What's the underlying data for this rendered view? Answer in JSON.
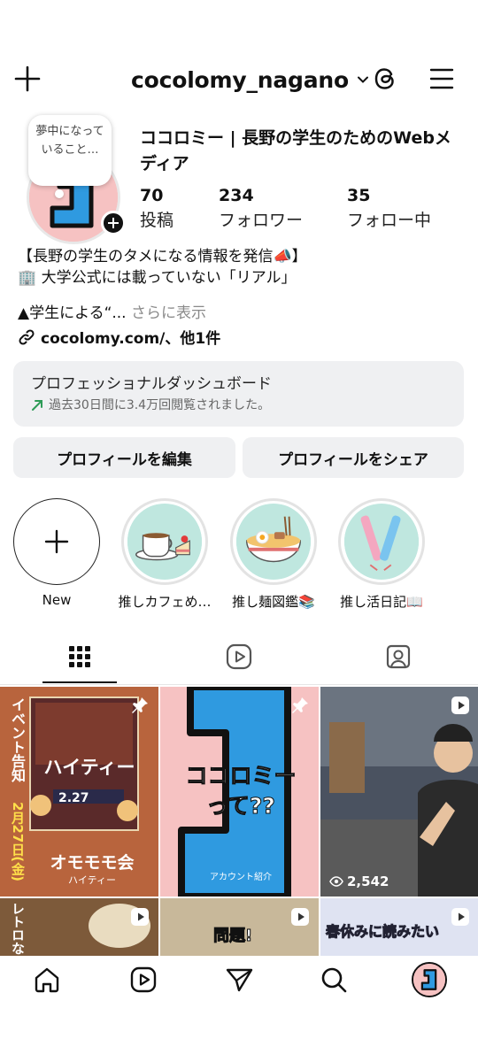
{
  "header": {
    "username": "cocolomy_nagano",
    "icons": [
      "plus-icon",
      "chevron-down-icon",
      "threads-icon",
      "hamburger-menu-icon"
    ]
  },
  "profile": {
    "note": "夢中になっていること…",
    "name": "ココロミー | 長野の学生のためのWebメディア",
    "stats": [
      {
        "value": "70",
        "label": "投稿"
      },
      {
        "value": "234",
        "label": "フォロワー"
      },
      {
        "value": "35",
        "label": "フォロー中"
      }
    ],
    "bio_line1": "【長野の学生のタメになる情報を発信📣】",
    "bio_line2": "🏢 大学公式には載っていない「リアル」",
    "bio_line3": "▲学生による“...",
    "bio_more": "さらに表示",
    "link": "cocolomy.com/、他1件"
  },
  "dashboard": {
    "title": "プロフェッショナルダッシュボード",
    "subtitle": "過去30日間に3.4万回閲覧されました。",
    "trend_color": "#2e9b57"
  },
  "buttons": {
    "edit": "プロフィールを編集",
    "share": "プロフィールをシェア"
  },
  "highlights": [
    {
      "label": "New"
    },
    {
      "label": "推しカフェめ…"
    },
    {
      "label": "推し麺図鑑📚"
    },
    {
      "label": "推し活日記📖"
    }
  ],
  "tabs": [
    "grid-icon",
    "reels-icon",
    "tagged-icon"
  ],
  "posts": [
    {
      "text_top": "イベント告知",
      "text_mid": "ハイティー",
      "text_date": "2.27",
      "text_date2": "2月27日(金)",
      "text_bottom": "オモモモ会",
      "text_bottom_sub": "ハイティー",
      "text_sign": "オモモモ会"
    },
    {
      "text": "ココロミーって??",
      "caption": "アカウント紹介"
    },
    {
      "views": "2,542"
    },
    {
      "text": "レトロな"
    },
    {
      "text": "問題!"
    },
    {
      "text": "春休みに読みたい"
    }
  ],
  "colors": {
    "accent": "#111111",
    "button_bg": "#eff0f2",
    "brand_blue": "#2f9ae0",
    "brand_pink": "#f6c2c2"
  }
}
